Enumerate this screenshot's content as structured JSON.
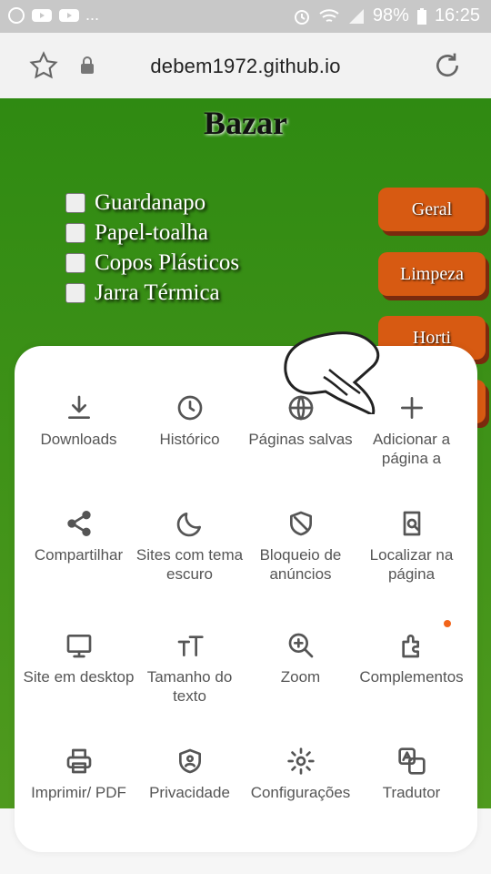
{
  "status_bar": {
    "ellipsis": "...",
    "battery": "98%",
    "time": "16:25"
  },
  "browser": {
    "url": "debem1972.github.io"
  },
  "page": {
    "title": "Bazar",
    "items": [
      {
        "label": "Guardanapo"
      },
      {
        "label": "Papel-toalha"
      },
      {
        "label": "Copos Plásticos"
      },
      {
        "label": "Jarra Térmica"
      }
    ],
    "categories": [
      {
        "label": "Geral"
      },
      {
        "label": "Limpeza"
      },
      {
        "label": "Horti"
      }
    ]
  },
  "menu": {
    "items": [
      {
        "label": "Downloads",
        "icon": "download-icon"
      },
      {
        "label": "Histórico",
        "icon": "history-icon"
      },
      {
        "label": "Páginas salvas",
        "icon": "saved-pages-icon"
      },
      {
        "label": "Adicionar a página a",
        "icon": "add-icon"
      },
      {
        "label": "Compartilhar",
        "icon": "share-icon"
      },
      {
        "label": "Sites com tema escuro",
        "icon": "moon-icon"
      },
      {
        "label": "Bloqueio de anúncios",
        "icon": "shield-icon"
      },
      {
        "label": "Localizar na página",
        "icon": "find-in-page-icon"
      },
      {
        "label": "Site em desktop",
        "icon": "desktop-icon"
      },
      {
        "label": "Tamanho do texto",
        "icon": "text-size-icon"
      },
      {
        "label": "Zoom",
        "icon": "zoom-icon"
      },
      {
        "label": "Complementos",
        "icon": "puzzle-icon"
      },
      {
        "label": "Imprimir/ PDF",
        "icon": "printer-icon"
      },
      {
        "label": "Privacidade",
        "icon": "privacy-icon"
      },
      {
        "label": "Configurações",
        "icon": "gear-icon"
      },
      {
        "label": "Tradutor",
        "icon": "translate-icon"
      }
    ]
  },
  "colors": {
    "page_bg": "#2f8a12",
    "category_button": "#d75a12",
    "notification_dot": "#f2641a"
  }
}
